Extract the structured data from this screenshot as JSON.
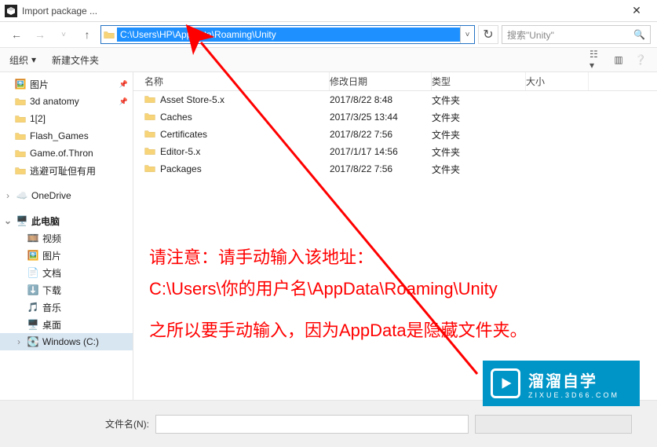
{
  "window": {
    "title": "Import package ..."
  },
  "address": {
    "path": "C:\\Users\\HP\\AppData\\Roaming\\Unity"
  },
  "search": {
    "placeholder": "搜索\"Unity\""
  },
  "toolbar": {
    "organize": "组织",
    "newfolder": "新建文件夹"
  },
  "columns": {
    "name": "名称",
    "date": "修改日期",
    "type": "类型",
    "size": "大小"
  },
  "tree": [
    {
      "label": "图片",
      "icon": "picture",
      "pinned": true
    },
    {
      "label": "3d anatomy",
      "icon": "folder",
      "pinned": true
    },
    {
      "label": "1[2]",
      "icon": "folder"
    },
    {
      "label": "Flash_Games",
      "icon": "folder"
    },
    {
      "label": "Game.of.Thron",
      "icon": "folder"
    },
    {
      "label": "逃避可耻但有用",
      "icon": "folder"
    }
  ],
  "tree_groups": [
    {
      "label": "OneDrive",
      "icon": "onedrive"
    },
    {
      "label": "此电脑",
      "icon": "pc"
    }
  ],
  "tree_pc": [
    {
      "label": "视频",
      "icon": "video"
    },
    {
      "label": "图片",
      "icon": "picture"
    },
    {
      "label": "文档",
      "icon": "doc"
    },
    {
      "label": "下载",
      "icon": "download"
    },
    {
      "label": "音乐",
      "icon": "music"
    },
    {
      "label": "桌面",
      "icon": "desktop"
    },
    {
      "label": "Windows (C:)",
      "icon": "drive",
      "selected": true
    }
  ],
  "files": [
    {
      "name": "Asset Store-5.x",
      "date": "2017/8/22 8:48",
      "type": "文件夹"
    },
    {
      "name": "Caches",
      "date": "2017/3/25 13:44",
      "type": "文件夹"
    },
    {
      "name": "Certificates",
      "date": "2017/8/22 7:56",
      "type": "文件夹"
    },
    {
      "name": "Editor-5.x",
      "date": "2017/1/17 14:56",
      "type": "文件夹"
    },
    {
      "name": "Packages",
      "date": "2017/8/22 7:56",
      "type": "文件夹"
    }
  ],
  "annotation": {
    "l1": "请注意：请手动输入该地址：",
    "l2": "C:\\Users\\你的用户名\\AppData\\Roaming\\Unity",
    "l3": "之所以要手动输入，因为AppData是隐藏文件夹。"
  },
  "bottom": {
    "label": "文件名(N):"
  },
  "badge": {
    "main": "溜溜自学",
    "sub": "ZIXUE.3D66.COM"
  }
}
